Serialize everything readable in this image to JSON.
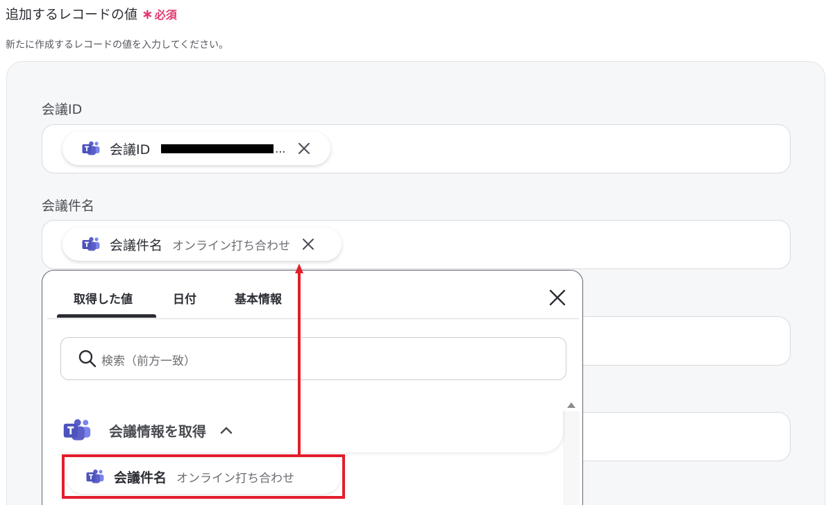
{
  "section": {
    "title": "追加するレコードの値",
    "required_mark": "∗",
    "required_label": "必須",
    "description": "新たに作成するレコードの値を入力してください。"
  },
  "fields": [
    {
      "label": "会議ID",
      "chip": {
        "label": "会議ID",
        "value_redacted": true,
        "ellipsis": "..."
      }
    },
    {
      "label": "会議件名",
      "chip": {
        "label": "会議件名",
        "value": "オンライン打ち合わせ"
      }
    }
  ],
  "dropdown": {
    "tabs": [
      "取得した値",
      "日付",
      "基本情報"
    ],
    "active_tab": 0,
    "search_placeholder": "検索（前方一致）",
    "group": {
      "label": "会議情報を取得",
      "expanded": true,
      "icon": "teams-icon"
    },
    "items": [
      {
        "label": "会議件名",
        "value": "オンライン打ち合わせ"
      }
    ]
  },
  "colors": {
    "required": "#e23a6f",
    "annotation": "#e31e2b",
    "teams": "#5b5fc7",
    "panel_bg": "#f6f7f9"
  }
}
